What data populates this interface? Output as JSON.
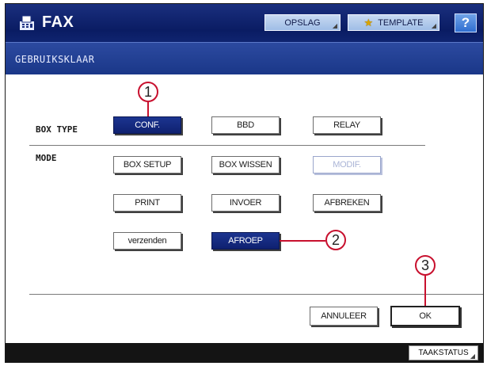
{
  "header": {
    "app_title": "FAX",
    "icon": "fax-machine-icon",
    "buttons": {
      "opslag": "OPSLAG",
      "template": "TEMPLATE",
      "help": "?"
    }
  },
  "status": {
    "text": "GEBRUIKSKLAAR"
  },
  "box_type": {
    "label": "BOX TYPE",
    "options": [
      "CONF.",
      "BBD",
      "RELAY"
    ],
    "selected": "CONF."
  },
  "mode": {
    "label": "MODE",
    "buttons": {
      "box_setup": "BOX SETUP",
      "box_wissen": "BOX WISSEN",
      "modif": "MODIF.",
      "print": "PRINT",
      "invoer": "INVOER",
      "afbreken": "AFBREKEN",
      "verzenden": "verzenden",
      "afroep": "AFROEP"
    },
    "selected": "AFROEP",
    "disabled": [
      "MODIF."
    ]
  },
  "actions": {
    "cancel": "ANNULEER",
    "ok": "OK"
  },
  "callouts": [
    "1",
    "2",
    "3"
  ],
  "footer": {
    "job_status": "TAAKSTATUS"
  },
  "colors": {
    "header_bg": "#0a1c63",
    "status_bg": "#1a3788",
    "selected_bg": "#0f2170",
    "callout_red": "#c8102e",
    "footer_bg": "#141414"
  }
}
